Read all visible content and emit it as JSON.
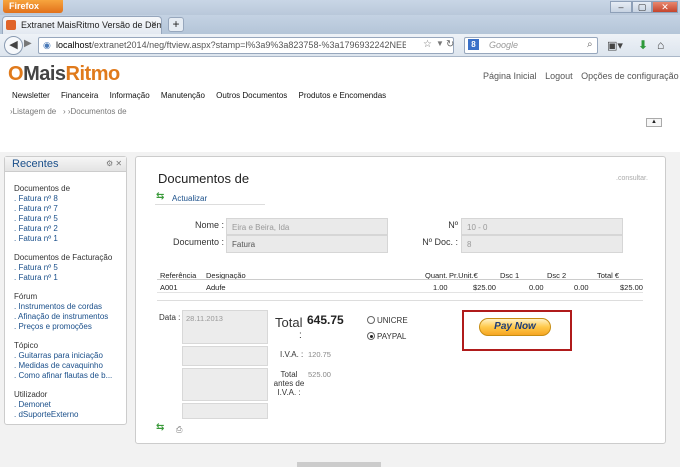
{
  "browser": {
    "app_button": "Firefox",
    "tab_title": "Extranet MaisRitmo Versão de Demonstr...",
    "new_tab": "+",
    "url_host": "localhost",
    "url_rest": "/extranet2014/neg/ftview.aspx?stamp=l%3a9%3a823758-%3a1796932242NEB&menufilter=1",
    "search_placeholder": "Google",
    "search_engine": "8"
  },
  "brand": {
    "logo_prefix": "O",
    "logo_text": "Mais",
    "logo_accent": "Ritmo",
    "accent_color": "#e07a1b"
  },
  "top_links": [
    "Página Inicial",
    "Logout",
    "Opções de configuração"
  ],
  "menu": [
    "Newsletter",
    "Financeira",
    "Informação",
    "Manutenção",
    "Outros Documentos",
    "Produtos e Encomendas"
  ],
  "breadcrumb": {
    "item1": "Listagem de",
    "item2": "Documentos de"
  },
  "sidebar": {
    "title": "Recentes",
    "groups": [
      {
        "title": "Documentos de",
        "items": [
          ". Fatura nº 8",
          ". Fatura nº 7",
          ". Fatura nº 5",
          ". Fatura nº 2",
          ". Fatura nº 1"
        ]
      },
      {
        "title": "Documentos de Facturação",
        "items": [
          ". Fatura nº 5",
          ". Fatura nº 1"
        ]
      },
      {
        "title": "Fórum",
        "items": [
          ". Instrumentos de cordas",
          ". Afinação de instrumentos",
          ". Preços e promoções"
        ]
      },
      {
        "title": "Tópico",
        "items": [
          ". Guitarras para iniciação",
          ". Medidas de cavaquinho",
          ". Como afinar flautas de b..."
        ]
      },
      {
        "title": "Utilizador",
        "items": [
          ". Demonet",
          ". dSuporteExterno"
        ]
      }
    ]
  },
  "document": {
    "title": "Documentos de",
    "consult_link": ".consultar.",
    "refresh_label": "Actualizar",
    "nome_label": "Nome :",
    "nome_value": "Eira e Beira, Ida",
    "documento_label": "Documento :",
    "documento_value": "Fatura",
    "num_label": "Nº",
    "num_value": "10 - 0",
    "numdoc_label": "Nº Doc. :",
    "numdoc_value": "8",
    "table": {
      "headers": [
        "Referência",
        "Designação",
        "Quant.",
        "Pr.Unit.€",
        "Dsc 1",
        "Dsc 2",
        "Total €"
      ],
      "rows": [
        [
          "A001",
          "Adufe",
          "1.00",
          "$25.00",
          "0.00",
          "0.00",
          "$25.00"
        ]
      ]
    },
    "data_label": "Data :",
    "data_value": "28.11.2013",
    "total_label": "Total",
    "total_value": "645.75",
    "total_colon": ":",
    "iva_label": "I.V.A. :",
    "iva_value": "120.75",
    "antes_label": "Total antes de I.V.A. :",
    "antes_value": "525.00",
    "payment_options": [
      "UNICRE",
      "PAYPAL"
    ],
    "selected_payment": "PAYPAL",
    "pay_button": "Pay Now"
  }
}
